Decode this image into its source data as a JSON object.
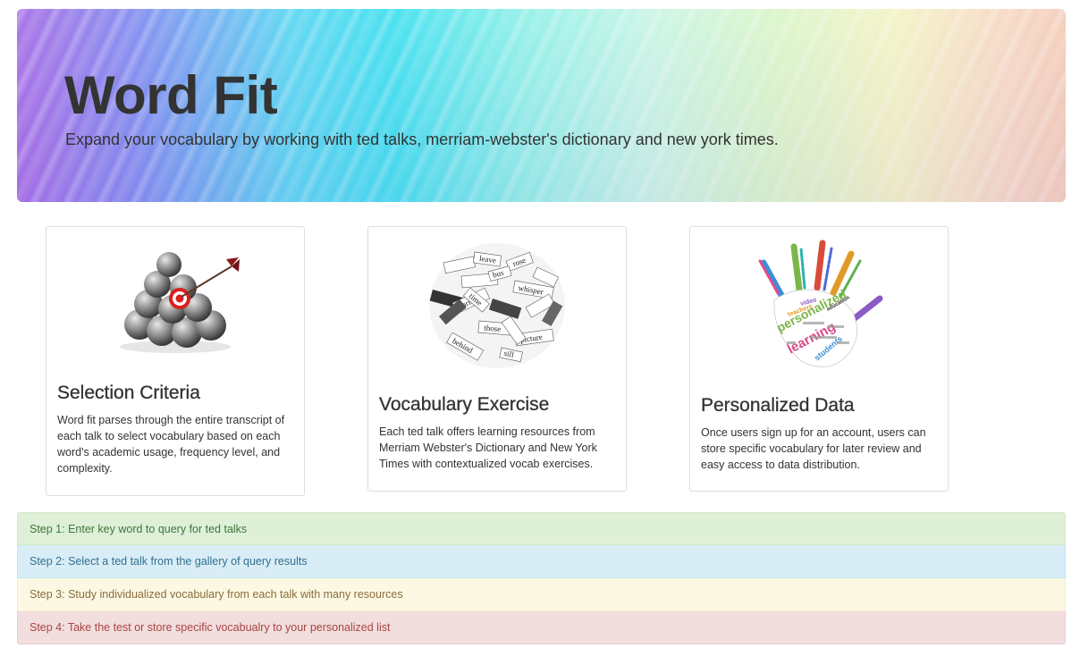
{
  "hero": {
    "title": "Word Fit",
    "subtitle": "Expand your vocabulary by working with ted talks, merriam-webster's dictionary and new york times."
  },
  "cards": [
    {
      "title": "Selection Criteria",
      "text": "Word fit parses through the entire transcript of each talk to select vocabulary based on each word's academic usage, frequency level, and complexity.",
      "image": "target-spheres-icon"
    },
    {
      "title": "Vocabulary Exercise",
      "text": "Each ted talk offers learning resources from Merriam Webster's Dictionary and New York Times with contextualized vocab exercises.",
      "image": "word-pile-icon",
      "image_words": [
        "leave",
        "rose",
        "whisper",
        "spring",
        "those",
        "behind",
        "picture",
        "time",
        "sill",
        "bus"
      ]
    },
    {
      "title": "Personalized Data",
      "text": "Once users sign up for an account, users can store specific vocabulary for later review and easy access to data distribution.",
      "image": "word-cloud-hand-icon",
      "image_words": [
        "personalized",
        "learning",
        "students",
        "teachers",
        "video",
        "education"
      ]
    }
  ],
  "steps": [
    "Step 1: Enter key word to query for ted talks",
    "Step 2: Select a ted talk from the gallery of query results",
    "Step 3: Study individualized vocabulary from each talk with many resources",
    "Step 4: Take the test or store specific vocabualry to your personalized list"
  ]
}
